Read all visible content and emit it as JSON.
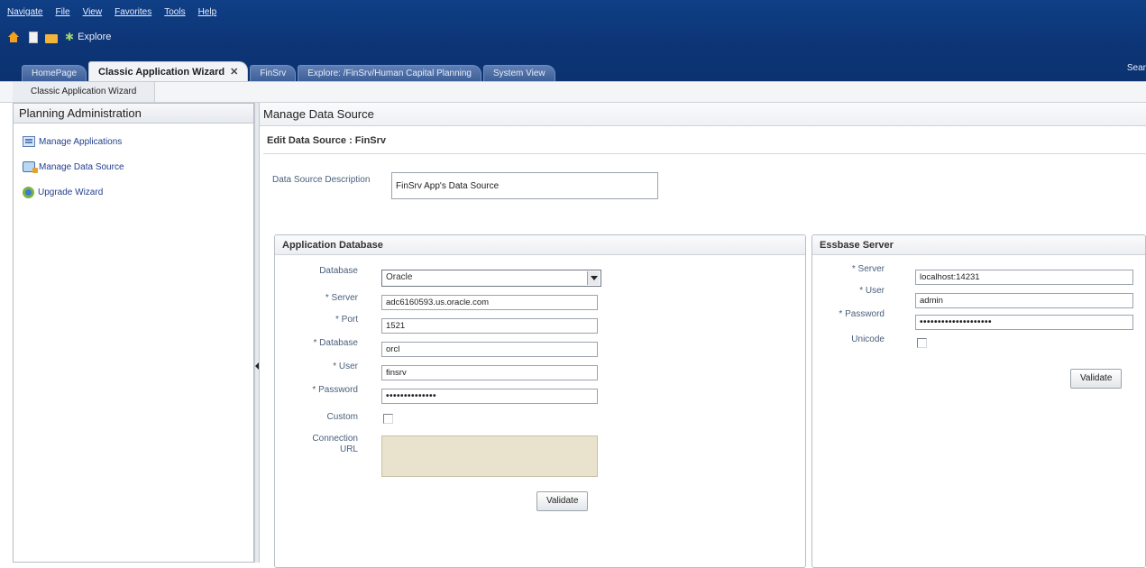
{
  "menu": {
    "items": [
      "Navigate",
      "File",
      "View",
      "Favorites",
      "Tools",
      "Help"
    ]
  },
  "toolbar": {
    "explore_label": "Explore"
  },
  "tabs": [
    {
      "label": "HomePage"
    },
    {
      "label": "Classic Application Wizard",
      "active": true
    },
    {
      "label": "FinSrv"
    },
    {
      "label": "Explore: /FinSrv/Human Capital Planning"
    },
    {
      "label": "System View"
    }
  ],
  "search_label": "Sear",
  "breadcrumb": {
    "label": "Classic Application Wizard"
  },
  "left_panel": {
    "title": "Planning Administration",
    "items": [
      {
        "label": "Manage Applications",
        "icon": "applications-icon"
      },
      {
        "label": "Manage Data Source",
        "icon": "data-source-icon"
      },
      {
        "label": "Upgrade Wizard",
        "icon": "upgrade-wizard-icon"
      }
    ]
  },
  "main": {
    "title": "Manage Data Source",
    "edit_title": "Edit Data Source : FinSrv",
    "description_label": "Data Source Description",
    "description_value": "FinSrv App's Data Source"
  },
  "app_db": {
    "title": "Application Database",
    "database_type_label": "Database",
    "database_type_value": "Oracle",
    "server_label": "* Server",
    "server_value": "adc6160593.us.oracle.com",
    "port_label": "* Port",
    "port_value": "1521",
    "database_label": "* Database",
    "database_value": "orcl",
    "user_label": "* User",
    "user_value": "finsrv",
    "password_label": "* Password",
    "password_value": "••••••••••••••",
    "custom_label": "Custom",
    "connection_url_label_1": "Connection",
    "connection_url_label_2": "URL",
    "validate_label": "Validate"
  },
  "essbase": {
    "title": "Essbase Server",
    "server_label": "* Server",
    "server_value": "localhost:14231",
    "user_label": "* User",
    "user_value": "admin",
    "password_label": "* Password",
    "password_value": "••••••••••••••••••••",
    "unicode_label": "Unicode",
    "validate_label": "Validate"
  }
}
